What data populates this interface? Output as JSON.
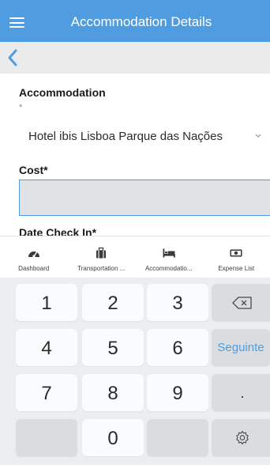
{
  "header": {
    "title": "Accommodation Details",
    "menu_icon": "hamburger-icon",
    "color": "#4f9de0"
  },
  "nav": {
    "back_icon": "chevron-left-icon"
  },
  "form": {
    "accommodation_label": "Accommodation",
    "accommodation_required_mark": "*",
    "accommodation_value": "Hotel ibis Lisboa Parque das Nações",
    "cost_label": "Cost*",
    "cost_value": "",
    "checkin_label": "Date Check In*"
  },
  "tabs": [
    {
      "label": "Dashboard",
      "icon": "dashboard-gauge-icon"
    },
    {
      "label": "Transportation ...",
      "icon": "suitcase-icon"
    },
    {
      "label": "Accommodatio...",
      "icon": "bed-icon"
    },
    {
      "label": "Expense List",
      "icon": "money-icon"
    }
  ],
  "keyboard": {
    "keys": [
      "1",
      "2",
      "3",
      "4",
      "5",
      "6",
      "7",
      "8",
      "9",
      "0"
    ],
    "backspace_icon": "backspace-icon",
    "next_label": "Seguinte",
    "dot_label": ".",
    "settings_icon": "gear-icon"
  }
}
